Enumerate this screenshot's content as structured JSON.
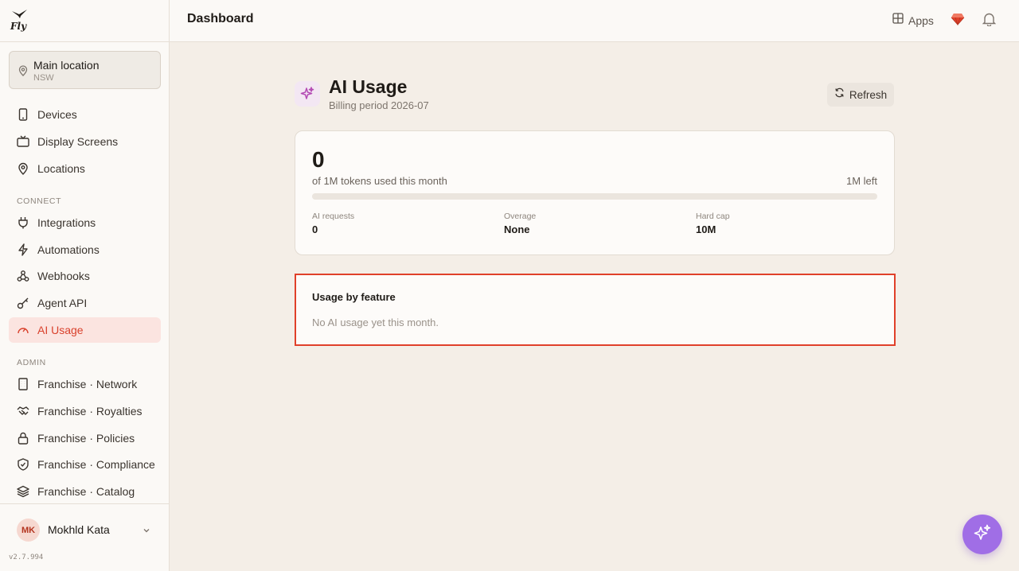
{
  "app": {
    "name": "Fly",
    "version": "v2.7.994"
  },
  "location": {
    "name": "Main location",
    "region": "NSW"
  },
  "sidebar": {
    "main_items": [
      {
        "label": "Devices",
        "icon": "phone-icon"
      },
      {
        "label": "Display Screens",
        "icon": "tv-icon"
      },
      {
        "label": "Locations",
        "icon": "map-pin-icon"
      }
    ],
    "connect_label": "CONNECT",
    "connect_items": [
      {
        "label": "Integrations",
        "icon": "plug-icon"
      },
      {
        "label": "Automations",
        "icon": "zap-icon"
      },
      {
        "label": "Webhooks",
        "icon": "webhook-icon"
      },
      {
        "label": "Agent API",
        "icon": "key-icon"
      },
      {
        "label": "AI Usage",
        "icon": "gauge-icon",
        "active": true
      }
    ],
    "admin_label": "ADMIN",
    "admin_items": [
      {
        "label": "Franchise · Network",
        "icon": "building-icon"
      },
      {
        "label": "Franchise · Royalties",
        "icon": "handshake-icon"
      },
      {
        "label": "Franchise · Policies",
        "icon": "lock-icon"
      },
      {
        "label": "Franchise · Compliance",
        "icon": "shield-icon"
      },
      {
        "label": "Franchise · Catalog",
        "icon": "layers-icon"
      }
    ]
  },
  "user": {
    "initials": "MK",
    "name": "Mokhld Kata"
  },
  "topbar": {
    "title": "Dashboard",
    "apps_label": "Apps"
  },
  "page": {
    "title": "AI Usage",
    "subtitle": "Billing period 2026-07",
    "refresh_label": "Refresh"
  },
  "usage": {
    "tokens_used": "0",
    "tokens_desc": "of 1M tokens used this month",
    "tokens_left": "1M left",
    "progress_percent": 0,
    "stats": [
      {
        "label": "AI requests",
        "value": "0"
      },
      {
        "label": "Overage",
        "value": "None"
      },
      {
        "label": "Hard cap",
        "value": "10M"
      }
    ]
  },
  "features": {
    "title": "Usage by feature",
    "empty_text": "No AI usage yet this month."
  },
  "colors": {
    "accent": "#d9412c",
    "assistant": "#a06ee6"
  }
}
